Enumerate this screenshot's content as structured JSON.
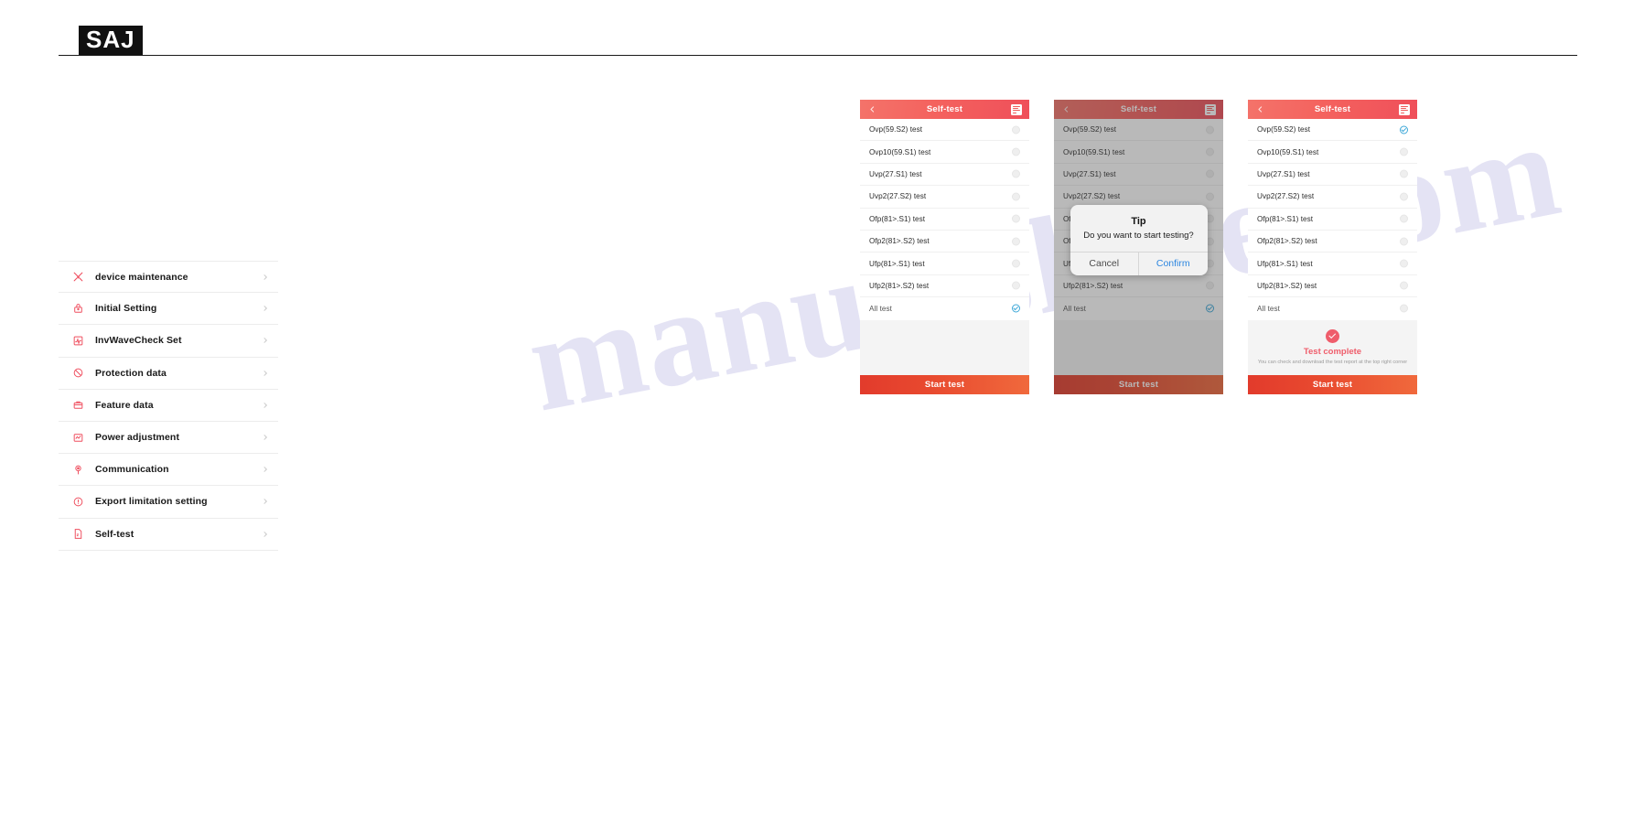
{
  "brand": {
    "logo_text": "SAJ"
  },
  "watermark": {
    "text": "manualshive.com"
  },
  "menu": {
    "items": [
      {
        "label": "device maintenance",
        "icon": "tools-icon"
      },
      {
        "label": "Initial Setting",
        "icon": "settings-gear-icon"
      },
      {
        "label": "InvWaveCheck Set",
        "icon": "waveform-icon"
      },
      {
        "label": "Protection data",
        "icon": "shield-block-icon"
      },
      {
        "label": "Feature data",
        "icon": "briefcase-icon"
      },
      {
        "label": "Power adjustment",
        "icon": "chart-adjust-icon"
      },
      {
        "label": "Communication",
        "icon": "antenna-signal-icon"
      },
      {
        "label": "Export limitation setting",
        "icon": "info-circle-icon"
      },
      {
        "label": "Self-test",
        "icon": "document-test-icon"
      }
    ],
    "chevron_icon": "chevron-right-icon"
  },
  "self_test": {
    "header": {
      "title": "Self-test",
      "back_icon": "chevron-left-icon",
      "report_icon": "report-document-icon"
    },
    "start_button_label": "Start test",
    "tests": [
      "Ovp(59.S2)  test",
      "Ovp10(59.S1)  test",
      "Uvp(27.S1)  test",
      "Uvp2(27.S2)  test",
      "Ofp(81>.S1)  test",
      "Ofp2(81>.S2)  test",
      "Ufp(81>.S1)  test",
      "Ufp2(81>.S2)  test"
    ],
    "all_test_label": "All  test"
  },
  "screen1": {
    "all_test_state": "checked",
    "test_states": [
      "unchecked",
      "unchecked",
      "unchecked",
      "unchecked",
      "unchecked",
      "unchecked",
      "unchecked",
      "unchecked"
    ]
  },
  "screen2": {
    "all_test_state": "checked",
    "dialog": {
      "title": "Tip",
      "message": "Do you want to start testing?",
      "cancel_label": "Cancel",
      "confirm_label": "Confirm"
    }
  },
  "screen3": {
    "test_states": [
      "checked",
      "unchecked",
      "unchecked",
      "unchecked",
      "unchecked",
      "unchecked",
      "unchecked",
      "unchecked"
    ],
    "all_test_state": "unchecked",
    "complete": {
      "icon": "check-circle-icon",
      "title": "Test complete",
      "subtitle": "You can check and download the test report at the top right corner"
    }
  },
  "colors": {
    "brand_red": "#ef4f5f",
    "header_gradient_start": "#f4736a",
    "header_gradient_end": "#ef4f5a",
    "button_gradient_start": "#e23b2c",
    "button_gradient_end": "#f0693c",
    "confirm_blue": "#2c86e0",
    "check_blue": "#3ea8d8"
  }
}
